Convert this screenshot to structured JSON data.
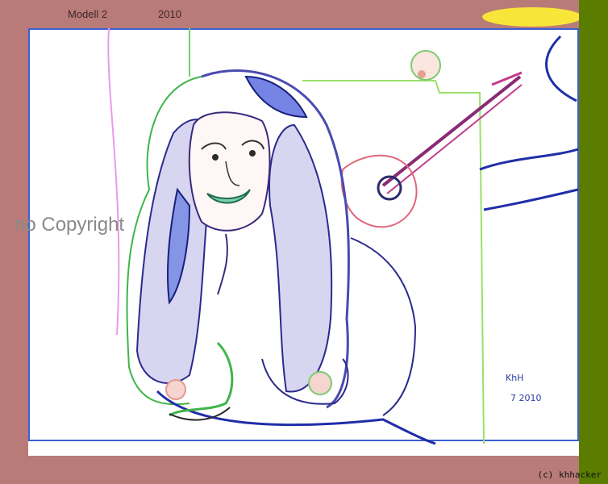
{
  "header": {
    "model_label": "Modell 2",
    "year_label": "2010"
  },
  "watermark": {
    "text": "no Copyright"
  },
  "footer": {
    "copyright": "(c) khhacker"
  },
  "colors": {
    "background": "#b97b78",
    "canvas": "#ffffff",
    "right_bar": "#5a7d00",
    "blob": "#f7e53a"
  }
}
